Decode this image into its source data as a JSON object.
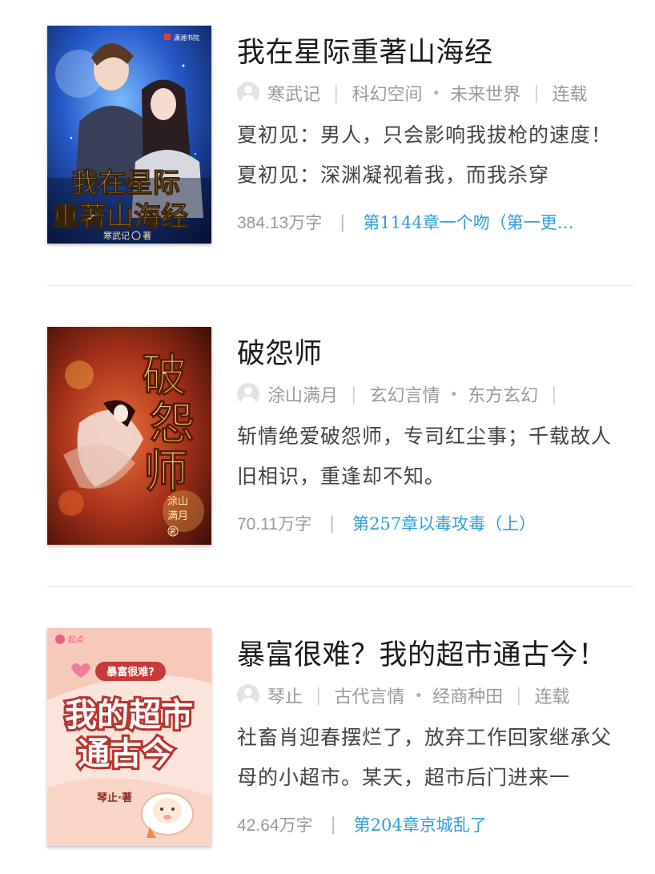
{
  "books": [
    {
      "title": "我在星际重著山海经",
      "author": "寒武记",
      "category": "科幻空间",
      "subcategory": "未来世界",
      "status": "连载",
      "description": "夏初见：男人，只会影响我拔枪的速度！夏初见：深渊凝视着我，而我杀穿",
      "word_count": "384.13",
      "word_unit": "万字",
      "latest_chapter": "第1144章一个吻（第一更…",
      "cover": {
        "title_line1": "我在星际",
        "title_line2": "重著山海经",
        "author_mark": "寒武记",
        "author_suffix": "著",
        "publisher": "潇湘书院",
        "accent": "#1e4fae"
      }
    },
    {
      "title": "破怨师",
      "author": "涂山满月",
      "category": "玄幻言情",
      "subcategory": "东方玄幻",
      "status": "",
      "description": "斩情绝爱破怨师，专司红尘事；千载故人旧相识，重逢却不知。",
      "word_count": "70.11",
      "word_unit": "万字",
      "latest_chapter": "第257章以毒攻毒（上）",
      "cover": {
        "title_line1": "破怨师",
        "author_mark": "涂山满月",
        "author_suffix": "著",
        "accent": "#8a1f10"
      }
    },
    {
      "title": "暴富很难？我的超市通古今！",
      "author": "琴止",
      "category": "古代言情",
      "subcategory": "经商种田",
      "status": "连载",
      "description": "社畜肖迎春摆烂了，放弃工作回家继承父母的小超市。某天，超市后门进来一",
      "word_count": "42.64",
      "word_unit": "万字",
      "latest_chapter": "第204章京城乱了",
      "cover": {
        "badge": "暴富很难?",
        "title_line1": "我的超市",
        "title_line2": "通古今",
        "author_mark": "琴止·著",
        "publisher": "起点",
        "accent": "#f3b8a8"
      }
    }
  ],
  "colors": {
    "link": "#2f9fd8",
    "meta_gray": "#9a9a9a",
    "divider": "#e6e6e6"
  }
}
